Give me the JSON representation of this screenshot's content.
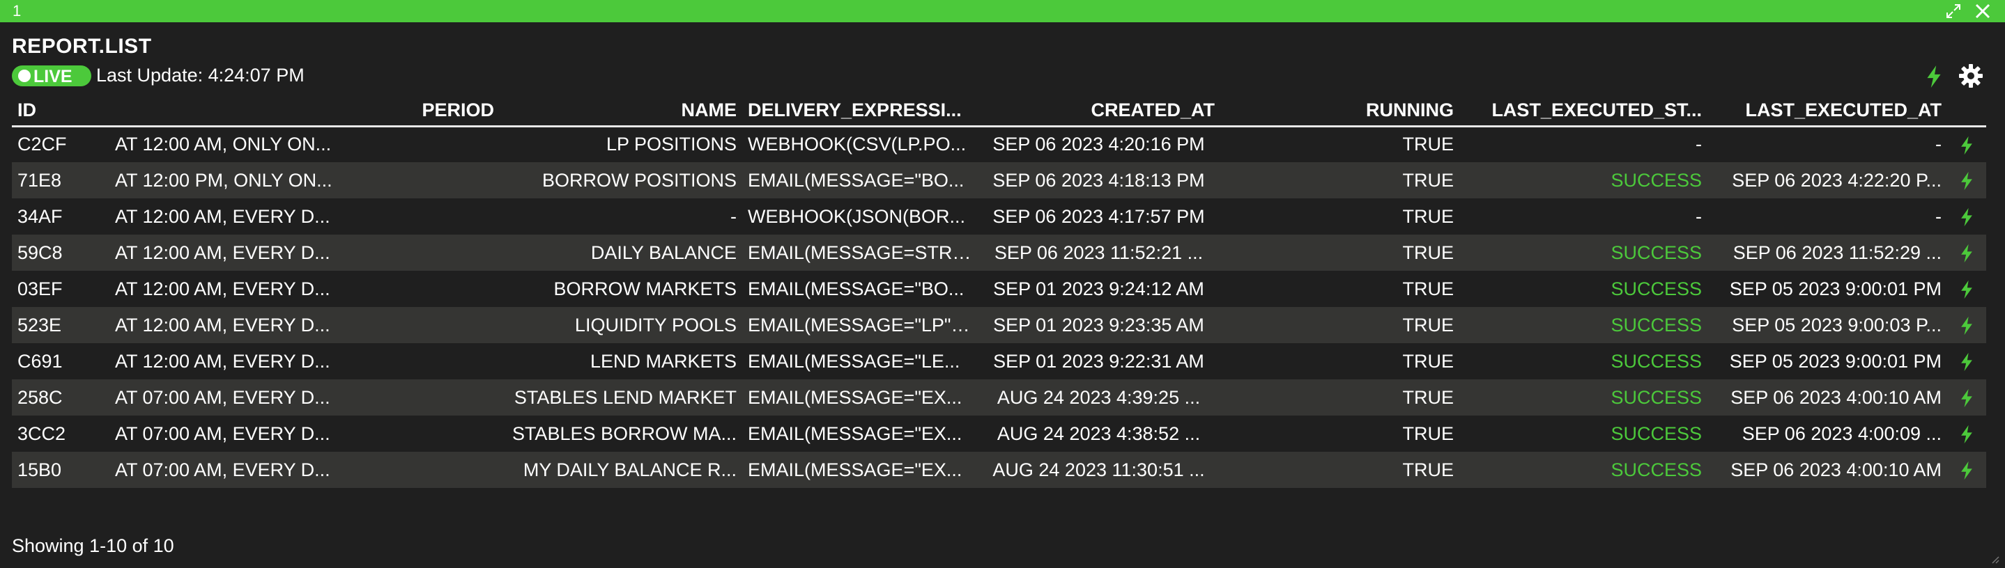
{
  "window": {
    "number": "1"
  },
  "header": {
    "title": "REPORT.LIST",
    "live_label": "LIVE",
    "last_update": "Last Update: 4:24:07 PM"
  },
  "colors": {
    "accent": "#4cc93b",
    "background": "#1f1f1f",
    "row_alt": "#353533"
  },
  "icons": [
    "expand-icon",
    "close-icon",
    "lightning-bolt-icon",
    "gear-icon",
    "resize-grip-icon"
  ],
  "table": {
    "columns": [
      "ID",
      "PERIOD",
      "NAME",
      "DELIVERY_EXPRESSI...",
      "CREATED_AT",
      "RUNNING",
      "LAST_EXECUTED_ST...",
      "LAST_EXECUTED_AT"
    ],
    "rows": [
      [
        "C2CF",
        "AT 12:00 AM, ONLY ON...",
        "LP POSITIONS",
        "WEBHOOK(CSV(LP.PO...",
        "SEP 06 2023 4:20:16 PM",
        "TRUE",
        "-",
        "-"
      ],
      [
        "71E8",
        "AT 12:00 PM, ONLY ON...",
        "BORROW POSITIONS",
        "EMAIL(MESSAGE=\"BO...",
        "SEP 06 2023 4:18:13 PM",
        "TRUE",
        "SUCCESS",
        "SEP 06 2023 4:22:20 P..."
      ],
      [
        "34AF",
        "AT 12:00 AM, EVERY D...",
        "-",
        "WEBHOOK(JSON(BOR...",
        "SEP 06 2023 4:17:57 PM",
        "TRUE",
        "-",
        "-"
      ],
      [
        "59C8",
        "AT 12:00 AM, EVERY D...",
        "DAILY BALANCE",
        "EMAIL(MESSAGE=STRI...",
        "SEP 06 2023 11:52:21 ...",
        "TRUE",
        "SUCCESS",
        "SEP 06 2023 11:52:29 ..."
      ],
      [
        "03EF",
        "AT 12:00 AM, EVERY D...",
        "BORROW MARKETS",
        "EMAIL(MESSAGE=\"BO...",
        "SEP 01 2023 9:24:12 AM",
        "TRUE",
        "SUCCESS",
        "SEP 05 2023 9:00:01 PM"
      ],
      [
        "523E",
        "AT 12:00 AM, EVERY D...",
        "LIQUIDITY POOLS",
        "EMAIL(MESSAGE=\"LP\",...",
        "SEP 01 2023 9:23:35 AM",
        "TRUE",
        "SUCCESS",
        "SEP 05 2023 9:00:03 P..."
      ],
      [
        "C691",
        "AT 12:00 AM, EVERY D...",
        "LEND MARKETS",
        "EMAIL(MESSAGE=\"LE...",
        "SEP 01 2023 9:22:31 AM",
        "TRUE",
        "SUCCESS",
        "SEP 05 2023 9:00:01 PM"
      ],
      [
        "258C",
        "AT 07:00 AM, EVERY D...",
        "STABLES LEND MARKET",
        "EMAIL(MESSAGE=\"EX...",
        "AUG 24 2023 4:39:25 ...",
        "TRUE",
        "SUCCESS",
        "SEP 06 2023 4:00:10 AM"
      ],
      [
        "3CC2",
        "AT 07:00 AM, EVERY D...",
        "STABLES BORROW MA...",
        "EMAIL(MESSAGE=\"EX...",
        "AUG 24 2023 4:38:52 ...",
        "TRUE",
        "SUCCESS",
        "SEP 06 2023 4:00:09 ..."
      ],
      [
        "15B0",
        "AT 07:00 AM, EVERY D...",
        "MY DAILY BALANCE R...",
        "EMAIL(MESSAGE=\"EX...",
        "AUG 24 2023 11:30:51 ...",
        "TRUE",
        "SUCCESS",
        "SEP 06 2023 4:00:10 AM"
      ]
    ]
  },
  "footer": {
    "showing": "Showing 1-10 of 10"
  }
}
